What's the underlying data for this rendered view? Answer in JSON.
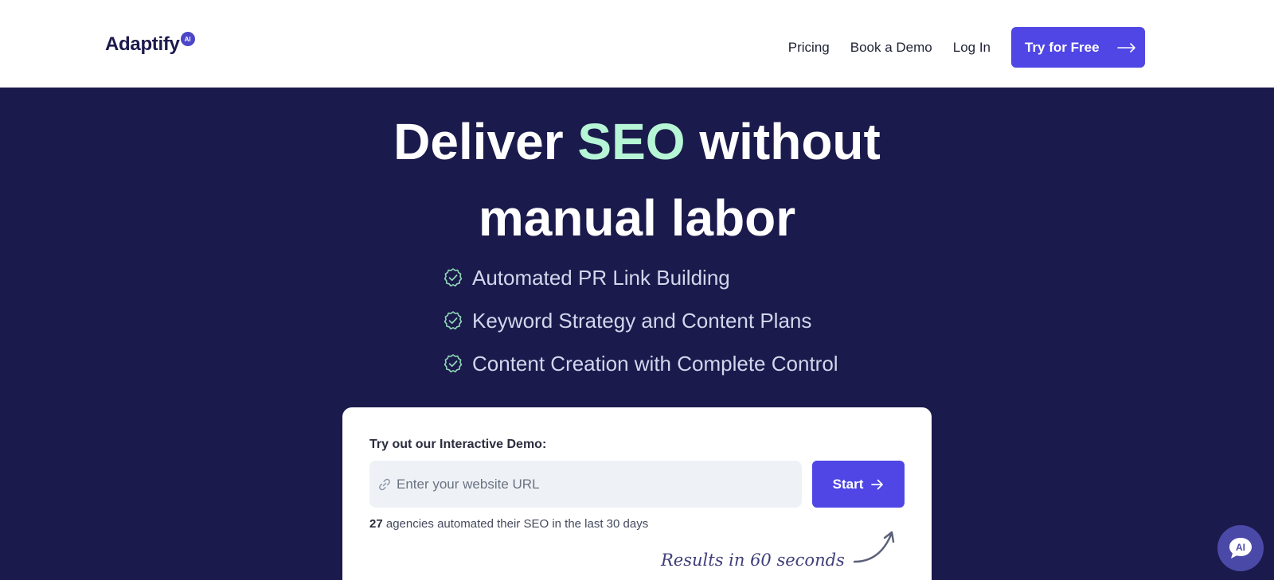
{
  "brand": {
    "name": "Adaptify",
    "badge": "AI"
  },
  "nav": {
    "links": [
      "Pricing",
      "Book a Demo",
      "Log In"
    ],
    "cta_label": "Try for Free"
  },
  "hero": {
    "title_part1": "Deliver",
    "title_accent": "SEO",
    "title_part2": "without",
    "title_line2": "manual labor",
    "features": [
      "Automated PR Link Building",
      "Keyword Strategy and Content Plans",
      "Content Creation with Complete Control"
    ]
  },
  "demo": {
    "label": "Try out our Interactive Demo:",
    "url_placeholder": "Enter your website URL",
    "start_label": "Start",
    "count": "27",
    "proof_text": "agencies automated their SEO in the last 30 days",
    "results_note": "Results in 60 seconds"
  },
  "chat": {
    "label": "AI"
  },
  "colors": {
    "hero_bg": "#1b1a4c",
    "accent": "#b6f5d5",
    "primary": "#4f46e5",
    "chat_bg": "#4b49a8"
  },
  "icons": {
    "check": "badge-check-icon",
    "link": "link-icon",
    "arrow": "arrow-right-icon",
    "chat": "chat-bubble-icon"
  }
}
